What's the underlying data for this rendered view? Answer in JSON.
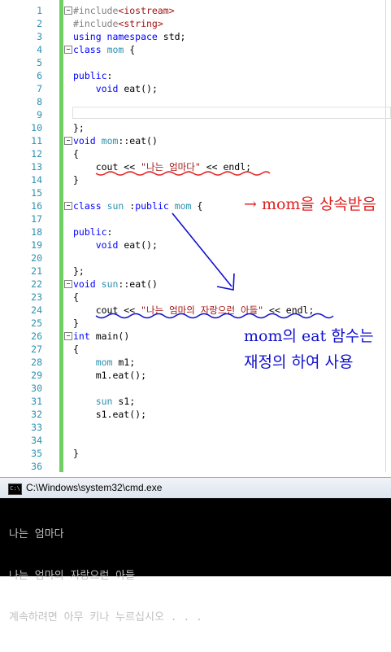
{
  "editor": {
    "lines": [
      {
        "n": "1",
        "fold": "⊟",
        "parts": [
          {
            "t": "#include",
            "c": "inc"
          },
          {
            "t": "<iostream>",
            "c": "str"
          }
        ]
      },
      {
        "n": "2",
        "fold": "",
        "parts": [
          {
            "t": "#include",
            "c": "inc"
          },
          {
            "t": "<string>",
            "c": "str"
          }
        ]
      },
      {
        "n": "3",
        "fold": "",
        "parts": [
          {
            "t": "using namespace",
            "c": "kw"
          },
          {
            "t": " std;",
            "c": ""
          }
        ]
      },
      {
        "n": "4",
        "fold": "⊟",
        "parts": [
          {
            "t": "class",
            "c": "kw"
          },
          {
            "t": " ",
            "c": ""
          },
          {
            "t": "mom",
            "c": "ty"
          },
          {
            "t": " {",
            "c": ""
          }
        ]
      },
      {
        "n": "5",
        "fold": "",
        "parts": []
      },
      {
        "n": "6",
        "fold": "",
        "parts": [
          {
            "t": "public",
            "c": "kw"
          },
          {
            "t": ":",
            "c": ""
          }
        ]
      },
      {
        "n": "7",
        "fold": "",
        "parts": [
          {
            "t": "    ",
            "c": ""
          },
          {
            "t": "void",
            "c": "kw"
          },
          {
            "t": " eat();",
            "c": ""
          }
        ]
      },
      {
        "n": "8",
        "fold": "",
        "parts": []
      },
      {
        "n": "9",
        "fold": "",
        "parts": []
      },
      {
        "n": "10",
        "fold": "",
        "parts": [
          {
            "t": "};",
            "c": ""
          }
        ]
      },
      {
        "n": "11",
        "fold": "⊟",
        "parts": [
          {
            "t": "void",
            "c": "kw"
          },
          {
            "t": " ",
            "c": ""
          },
          {
            "t": "mom",
            "c": "ty"
          },
          {
            "t": "::eat()",
            "c": ""
          }
        ]
      },
      {
        "n": "12",
        "fold": "",
        "parts": [
          {
            "t": "{",
            "c": ""
          }
        ]
      },
      {
        "n": "13",
        "fold": "",
        "parts": [
          {
            "t": "    cout << ",
            "c": ""
          },
          {
            "t": "\"나는 엄마다\"",
            "c": "str"
          },
          {
            "t": " << endl;",
            "c": ""
          }
        ]
      },
      {
        "n": "14",
        "fold": "",
        "parts": [
          {
            "t": "}",
            "c": ""
          }
        ]
      },
      {
        "n": "15",
        "fold": "",
        "parts": []
      },
      {
        "n": "16",
        "fold": "⊟",
        "parts": [
          {
            "t": "class",
            "c": "kw"
          },
          {
            "t": " ",
            "c": ""
          },
          {
            "t": "sun",
            "c": "ty"
          },
          {
            "t": " :",
            "c": ""
          },
          {
            "t": "public",
            "c": "kw"
          },
          {
            "t": " ",
            "c": ""
          },
          {
            "t": "mom",
            "c": "ty"
          },
          {
            "t": " {",
            "c": ""
          }
        ]
      },
      {
        "n": "17",
        "fold": "",
        "parts": []
      },
      {
        "n": "18",
        "fold": "",
        "parts": [
          {
            "t": "public",
            "c": "kw"
          },
          {
            "t": ":",
            "c": ""
          }
        ]
      },
      {
        "n": "19",
        "fold": "",
        "parts": [
          {
            "t": "    ",
            "c": ""
          },
          {
            "t": "void",
            "c": "kw"
          },
          {
            "t": " eat();",
            "c": ""
          }
        ]
      },
      {
        "n": "20",
        "fold": "",
        "parts": []
      },
      {
        "n": "21",
        "fold": "",
        "parts": [
          {
            "t": "};",
            "c": ""
          }
        ]
      },
      {
        "n": "22",
        "fold": "⊟",
        "parts": [
          {
            "t": "void",
            "c": "kw"
          },
          {
            "t": " ",
            "c": ""
          },
          {
            "t": "sun",
            "c": "ty"
          },
          {
            "t": "::eat()",
            "c": ""
          }
        ]
      },
      {
        "n": "23",
        "fold": "",
        "parts": [
          {
            "t": "{",
            "c": ""
          }
        ]
      },
      {
        "n": "24",
        "fold": "",
        "parts": [
          {
            "t": "    cout << ",
            "c": ""
          },
          {
            "t": "\"나는 엄마의 자랑으런 아들\"",
            "c": "str"
          },
          {
            "t": " << endl;",
            "c": ""
          }
        ]
      },
      {
        "n": "25",
        "fold": "",
        "parts": [
          {
            "t": "}",
            "c": ""
          }
        ]
      },
      {
        "n": "26",
        "fold": "⊟",
        "parts": [
          {
            "t": "int",
            "c": "kw"
          },
          {
            "t": " main()",
            "c": ""
          }
        ]
      },
      {
        "n": "27",
        "fold": "",
        "parts": [
          {
            "t": "{",
            "c": ""
          }
        ]
      },
      {
        "n": "28",
        "fold": "",
        "parts": [
          {
            "t": "    ",
            "c": ""
          },
          {
            "t": "mom",
            "c": "ty"
          },
          {
            "t": " m1;",
            "c": ""
          }
        ]
      },
      {
        "n": "29",
        "fold": "",
        "parts": [
          {
            "t": "    m1.eat();",
            "c": ""
          }
        ]
      },
      {
        "n": "30",
        "fold": "",
        "parts": []
      },
      {
        "n": "31",
        "fold": "",
        "parts": [
          {
            "t": "    ",
            "c": ""
          },
          {
            "t": "sun",
            "c": "ty"
          },
          {
            "t": " s1;",
            "c": ""
          }
        ]
      },
      {
        "n": "32",
        "fold": "",
        "parts": [
          {
            "t": "    s1.eat();",
            "c": ""
          }
        ]
      },
      {
        "n": "33",
        "fold": "",
        "parts": []
      },
      {
        "n": "34",
        "fold": "",
        "parts": []
      },
      {
        "n": "35",
        "fold": "",
        "parts": [
          {
            "t": "}",
            "c": ""
          }
        ]
      },
      {
        "n": "36",
        "fold": "",
        "parts": []
      }
    ]
  },
  "annotations": {
    "red_note": "→ mom을 상속받음",
    "blue_note_line1": "mom의 eat 함수는",
    "blue_note_line2": "재정의 하여 사용"
  },
  "console": {
    "title": "C:\\Windows\\system32\\cmd.exe",
    "icon": "cmd-icon",
    "output": [
      "나는 엄마다",
      "나는 엄마의 자랑으런 아들",
      "계속하려면 아무 키나 누르십시오 . . ."
    ]
  },
  "colors": {
    "keyword": "#0000ff",
    "string": "#a31515",
    "type": "#2b91af",
    "change_bar": "#6fcf62",
    "red_ink": "#e02020",
    "blue_ink": "#1010d0"
  }
}
